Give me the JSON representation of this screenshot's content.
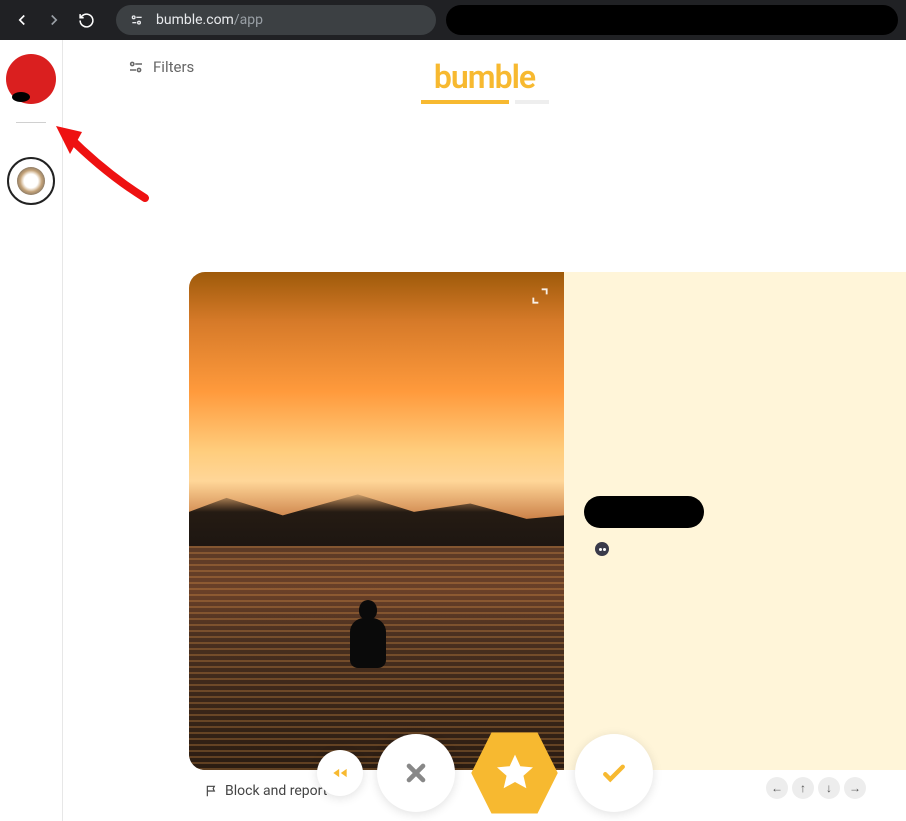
{
  "browser": {
    "url_host": "bumble.com",
    "url_path": "/app"
  },
  "header": {
    "filters_label": "Filters",
    "brand": "bumble"
  },
  "card": {
    "block_report_label": "Block and report"
  },
  "icons": {
    "back": "back-icon",
    "forward": "forward-icon",
    "reload": "reload-icon",
    "site_settings": "site-settings-icon",
    "filters": "tune-icon",
    "expand": "expand-icon",
    "flag": "flag-icon",
    "rewind": "rewind-icon",
    "pass": "x-icon",
    "super": "star-icon",
    "like": "check-icon",
    "arrow_left": "←",
    "arrow_up": "↑",
    "arrow_down": "↓",
    "arrow_right": "→"
  },
  "colors": {
    "accent": "#f7b930",
    "info_bg": "#fff5d9"
  }
}
